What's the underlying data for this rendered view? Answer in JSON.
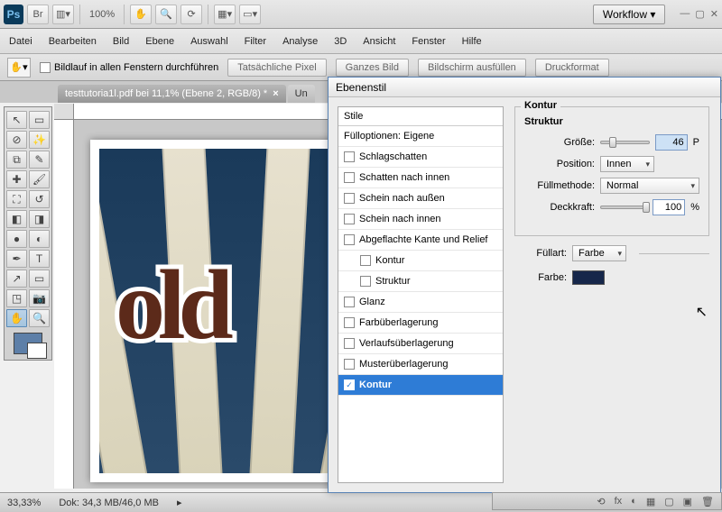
{
  "app": {
    "logo": "Ps",
    "zoom_pct": "100%",
    "workflow": "Workflow ▾"
  },
  "menu": [
    "Datei",
    "Bearbeiten",
    "Bild",
    "Ebene",
    "Auswahl",
    "Filter",
    "Analyse",
    "3D",
    "Ansicht",
    "Fenster",
    "Hilfe"
  ],
  "options": {
    "scroll_all": "Bildlauf in allen Fenstern durchführen",
    "buttons": [
      "Tatsächliche Pixel",
      "Ganzes Bild",
      "Bildschirm ausfüllen",
      "Druckformat"
    ]
  },
  "tabs": {
    "active": "testtutoria1l.pdf bei 11,1% (Ebene 2, RGB/8) *",
    "inactive": "Un"
  },
  "canvas_text": "old",
  "status": {
    "zoom": "33,33%",
    "doc": "Dok: 34,3 MB/46,0 MB"
  },
  "dialog": {
    "title": "Ebenenstil",
    "list_head": "Stile",
    "fill_opts": "Fülloptionen: Eigene",
    "items": [
      {
        "label": "Schlagschatten",
        "sub": false,
        "chk": false
      },
      {
        "label": "Schatten nach innen",
        "sub": false,
        "chk": false
      },
      {
        "label": "Schein nach außen",
        "sub": false,
        "chk": false
      },
      {
        "label": "Schein nach innen",
        "sub": false,
        "chk": false
      },
      {
        "label": "Abgeflachte Kante und Relief",
        "sub": false,
        "chk": false
      },
      {
        "label": "Kontur",
        "sub": true,
        "chk": false
      },
      {
        "label": "Struktur",
        "sub": true,
        "chk": false
      },
      {
        "label": "Glanz",
        "sub": false,
        "chk": false
      },
      {
        "label": "Farbüberlagerung",
        "sub": false,
        "chk": false
      },
      {
        "label": "Verlaufsüberlagerung",
        "sub": false,
        "chk": false
      },
      {
        "label": "Musterüberlagerung",
        "sub": false,
        "chk": false
      },
      {
        "label": "Kontur",
        "sub": false,
        "chk": true,
        "sel": true
      }
    ],
    "panel": {
      "section": "Kontur",
      "struct": "Struktur",
      "size_label": "Größe:",
      "size_val": "46",
      "size_unit": "P",
      "position_label": "Position:",
      "position_val": "Innen",
      "blend_label": "Füllmethode:",
      "blend_val": "Normal",
      "opacity_label": "Deckkraft:",
      "opacity_val": "100",
      "opacity_unit": "%",
      "filltype_label": "Füllart:",
      "filltype_val": "Farbe",
      "color_label": "Farbe:",
      "color_val": "#16274a"
    }
  },
  "layers_icons": [
    "⟲",
    "fx",
    "◐",
    "▦",
    "▢",
    "▣",
    "⬚",
    "🗑"
  ]
}
